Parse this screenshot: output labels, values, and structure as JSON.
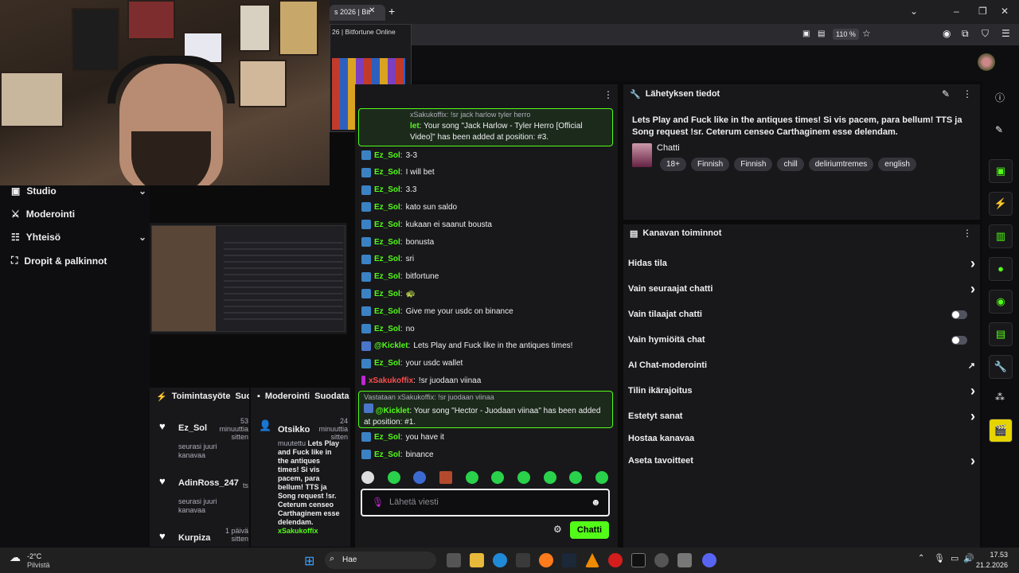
{
  "browser": {
    "tab_title": "s 2026 | Bit",
    "new_tab": "+",
    "zoom": "110 %"
  },
  "thumb": {
    "title": "26 | Bitfortune Online"
  },
  "leftnav": {
    "items": [
      {
        "label": "Studio"
      },
      {
        "label": "Moderointi"
      },
      {
        "label": "Yhteisö"
      },
      {
        "label": "Dropit & palkinnot"
      }
    ]
  },
  "activity": {
    "header": "Toimintasyöte",
    "header2": "Suod",
    "items": [
      {
        "name": "Ez_Sol",
        "time": "53 minuuttia sitten",
        "sub": "seurasi juuri kanavaa"
      },
      {
        "name": "AdinRoss_247",
        "time": "ts",
        "sub": "seurasi juuri kanavaa"
      },
      {
        "name": "Kurpiza",
        "time": "1 päivä sitten",
        "sub": ""
      }
    ]
  },
  "moderation": {
    "header": "Moderointi",
    "header2": "Suodata",
    "item": {
      "name": "Otsikko",
      "time": "24 minuuttia sitten",
      "sub_prefix": "muutettu",
      "sub": "Lets Play and Fuck like in the antiques times! Si vis pacem, para bellum! TTS ja Song request !sr. Ceterum censeo Carthaginem esse delendam.",
      "by": "xSakukoffix"
    }
  },
  "chat": {
    "pinned": {
      "reply": "xSakukoffix: !sr jack harlow tyler herro",
      "user": "let",
      "text": "Your song \"Jack Harlow - Tyler Herro [Official Video]\" has been added at position: #3."
    },
    "messages": [
      {
        "user": "Ez_Sol",
        "text": "3-3"
      },
      {
        "user": "Ez_Sol",
        "text": "I will bet"
      },
      {
        "user": "Ez_Sol",
        "text": "3.3"
      },
      {
        "user": "Ez_Sol",
        "text": "kato sun saldo"
      },
      {
        "user": "Ez_Sol",
        "text": "kukaan ei saanut bousta"
      },
      {
        "user": "Ez_Sol",
        "text": "bonusta"
      },
      {
        "user": "Ez_Sol",
        "text": "sri"
      },
      {
        "user": "Ez_Sol",
        "text": "bitfortune"
      },
      {
        "user": "Ez_Sol",
        "text": "🐢"
      },
      {
        "user": "Ez_Sol",
        "text": "Give me your usdc on binance"
      },
      {
        "user": "Ez_Sol",
        "text": "no"
      },
      {
        "user": "@Kicklet",
        "text": "Lets Play and Fuck like in the antiques times!"
      },
      {
        "user": "Ez_Sol",
        "text": "your usdc wallet"
      },
      {
        "user": "xSakukoffix",
        "text": "!sr juodaan viinaa"
      }
    ],
    "reply": {
      "reply": "Vastataan xSakukoffix: !sr juodaan viinaa",
      "user": "@Kicklet",
      "text": "Your song \"Hector - Juodaan viinaa\" has been added at position: #1."
    },
    "after": [
      {
        "user": "Ez_Sol",
        "text": "you have it"
      },
      {
        "user": "Ez_Sol",
        "text": "binance"
      }
    ],
    "input_placeholder": "Lähetä viesti",
    "send_label": "Chatti"
  },
  "info": {
    "header": "Lähetyksen tiedot",
    "title": "Lets Play and Fuck like in the antiques times! Si vis pacem, para bellum! TTS ja Song request !sr. Ceterum censeo Carthaginem esse delendam.",
    "category": "Chatti",
    "tags": [
      "18+",
      "Finnish",
      "Finnish",
      "chill",
      "deliriumtremes",
      "english"
    ]
  },
  "actions": {
    "header": "Kanavan toiminnot",
    "rows": [
      {
        "label": "Hidas tila",
        "ctl": "chevron"
      },
      {
        "label": "Vain seuraajat chatti",
        "ctl": "chevron"
      },
      {
        "label": "Vain tilaajat chatti",
        "ctl": "toggle"
      },
      {
        "label": "Vain hymiöitä chat",
        "ctl": "toggle"
      },
      {
        "label": "AI Chat-moderointi",
        "ctl": "external"
      },
      {
        "label": "Tilin ikärajoitus",
        "ctl": "chevron"
      },
      {
        "label": "Estetyt sanat",
        "ctl": "chevron"
      },
      {
        "label": "Hostaa kanavaa",
        "ctl": "none"
      },
      {
        "label": "Aseta tavoitteet",
        "ctl": "chevron"
      }
    ]
  },
  "taskbar": {
    "weather_temp": "-2°C",
    "weather_desc": "Pilvistä",
    "search": "Hae",
    "time": "17.53",
    "date": "21.2.2026"
  },
  "colors": {
    "accent": "#53fc18",
    "panel": "#18181b",
    "bg": "#0e0e10"
  }
}
